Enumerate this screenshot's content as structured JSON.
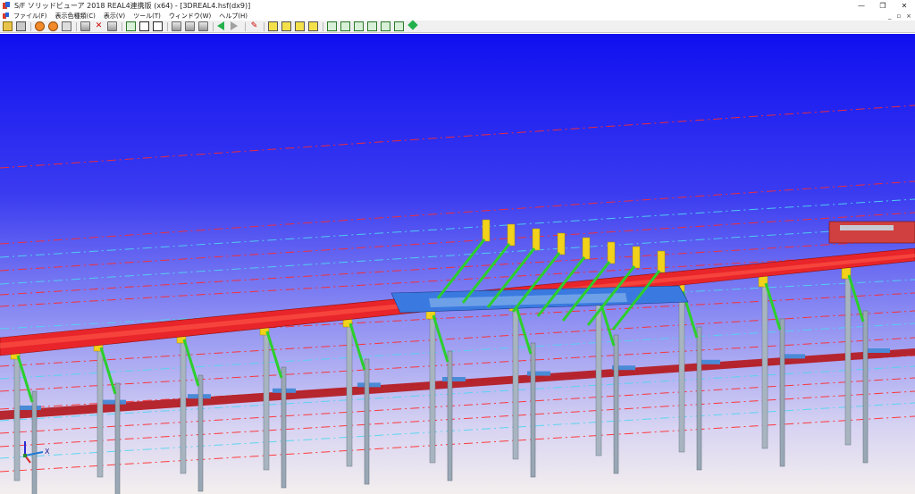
{
  "window": {
    "title": "S/F ソリッドビューア 2018 REAL4連携版 (x64) - [3DREAL4.hsf(dx9)]",
    "minimize": "—",
    "maximize": "❐",
    "close": "✕"
  },
  "menu": {
    "items": [
      "ファイル(F)",
      "表示色種類(C)",
      "表示(V)",
      "ツール(T)",
      "ウィンドウ(W)",
      "ヘルプ(H)"
    ],
    "mdi_minimize": "_",
    "mdi_restore": "▫",
    "mdi_close": "×"
  },
  "colors": {
    "sky_top": "#1010f0",
    "sky_mid": "#6d6ff0",
    "ground": "#f2eef0",
    "deck": "#e8252a",
    "cap": "#f2d21a",
    "brace": "#2ccf2c",
    "pier": "#a8b4c0",
    "blue_deck": "#3a7ae0",
    "line_red": "#ff2a2a",
    "line_cyan": "#4fd6f0"
  },
  "icons": {
    "axis_indicator": "xyz-axis-icon"
  }
}
